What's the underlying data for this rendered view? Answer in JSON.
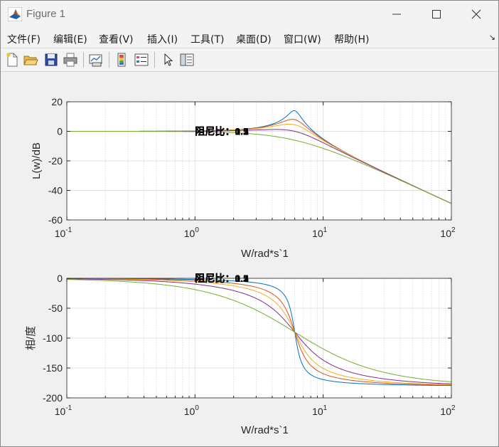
{
  "window": {
    "title": "Figure 1",
    "menu": [
      "文件(F)",
      "编辑(E)",
      "查看(V)",
      "插入(I)",
      "工具(T)",
      "桌面(D)",
      "窗口(W)",
      "帮助(H)"
    ],
    "menu_overflow": "↘",
    "toolbar_icons": [
      "new-figure-icon",
      "open-file-icon",
      "save-icon",
      "print-icon",
      "link-plot-icon",
      "colorbar-icon",
      "legend-icon",
      "pointer-icon",
      "property-editor-icon"
    ]
  },
  "colors": {
    "series": [
      "#0072BD",
      "#D95319",
      "#EDB120",
      "#7E2F8E",
      "#77AC30"
    ]
  },
  "chart_data": [
    {
      "type": "line",
      "subtype": "bode-magnitude",
      "xscale": "log",
      "xlim": [
        0.1,
        100
      ],
      "ylim": [
        -60,
        20
      ],
      "xticks": [
        0.1,
        1,
        10,
        100
      ],
      "xtick_labels": [
        {
          "base": "10",
          "exp": "-1"
        },
        {
          "base": "10",
          "exp": "0"
        },
        {
          "base": "10",
          "exp": "1"
        },
        {
          "base": "10",
          "exp": "2"
        }
      ],
      "yticks": [
        -60,
        -40,
        -20,
        0,
        20
      ],
      "ytick_labels": [
        "-60",
        "-40",
        "-20",
        "0",
        "20"
      ],
      "xlabel": "W/rad*s`1",
      "ylabel": "L(w)/dB",
      "grid": true,
      "annotation": {
        "prefix": "阻尼比：",
        "values": [
          "0.1",
          "0.2",
          "0.3",
          "0.5",
          "1"
        ],
        "x": 1,
        "y": 0
      },
      "omega_n": 6,
      "zetas": [
        0.1,
        0.2,
        0.3,
        0.5,
        1
      ],
      "series": [
        {
          "x": [
            0.1,
            1,
            3,
            5,
            6,
            7,
            10,
            20,
            50,
            100
          ],
          "values": [
            0.0,
            0.2,
            1.1,
            7.6,
            14.0,
            7.0,
            -2.1,
            -15.0,
            -36.8,
            -48.9
          ]
        },
        {
          "x": [
            0.1,
            1,
            3,
            5,
            6,
            7,
            10,
            20,
            50,
            100
          ],
          "values": [
            0.0,
            0.2,
            1.0,
            4.8,
            8.0,
            5.0,
            -2.3,
            -15.1,
            -36.8,
            -48.9
          ]
        },
        {
          "x": [
            0.1,
            1,
            3,
            5,
            6,
            7,
            10,
            20,
            50,
            100
          ],
          "values": [
            0.0,
            0.2,
            0.8,
            2.6,
            4.4,
            2.9,
            -2.8,
            -15.3,
            -36.8,
            -48.9
          ]
        },
        {
          "x": [
            0.1,
            1,
            3,
            5,
            6,
            7,
            10,
            20,
            50,
            100
          ],
          "values": [
            0.0,
            0.1,
            0.2,
            0.6,
            0.0,
            -0.8,
            -4.6,
            -15.8,
            -36.9,
            -48.9
          ]
        },
        {
          "x": [
            0.1,
            1,
            3,
            5,
            6,
            7,
            10,
            20,
            50,
            100
          ],
          "values": [
            0.0,
            -0.2,
            -1.9,
            -4.8,
            -6.0,
            -7.4,
            -10.6,
            -21.4,
            -38.1,
            -49.2
          ]
        }
      ]
    },
    {
      "type": "line",
      "subtype": "bode-phase",
      "xscale": "log",
      "xlim": [
        0.1,
        100
      ],
      "ylim": [
        -200,
        0
      ],
      "xticks": [
        0.1,
        1,
        10,
        100
      ],
      "xtick_labels": [
        {
          "base": "10",
          "exp": "-1"
        },
        {
          "base": "10",
          "exp": "0"
        },
        {
          "base": "10",
          "exp": "1"
        },
        {
          "base": "10",
          "exp": "2"
        }
      ],
      "yticks": [
        -200,
        -150,
        -100,
        -50,
        0
      ],
      "ytick_labels": [
        "-200",
        "-150",
        "-100",
        "-50",
        "0"
      ],
      "xlabel": "W/rad*s`1",
      "ylabel": "相/度",
      "grid": true,
      "annotation": {
        "prefix": "阻尼比：",
        "values": [
          "0.1",
          "0.2",
          "0.3",
          "0.5",
          "1"
        ],
        "x": 1,
        "y": 0
      },
      "omega_n": 6,
      "zetas": [
        0.1,
        0.2,
        0.3,
        0.5,
        1
      ],
      "series": [
        {
          "x": [
            0.1,
            1,
            3,
            5,
            6,
            7,
            10,
            20,
            50,
            100
          ],
          "values": [
            -0.2,
            -2.0,
            -7.6,
            -40.1,
            -90.0,
            -145.0,
            -167.0,
            -176.5,
            -178.6,
            -179.3
          ]
        },
        {
          "x": [
            0.1,
            1,
            3,
            5,
            6,
            7,
            10,
            20,
            50,
            100
          ],
          "values": [
            -0.4,
            -3.9,
            -15.0,
            -59.0,
            -90.0,
            -122.0,
            -154.0,
            -173.0,
            -177.2,
            -178.6
          ]
        },
        {
          "x": [
            0.1,
            1,
            3,
            5,
            6,
            7,
            10,
            20,
            50,
            100
          ],
          "values": [
            -0.6,
            -5.9,
            -21.8,
            -67.0,
            -90.0,
            -112.0,
            -142.0,
            -169.6,
            -175.9,
            -177.9
          ]
        },
        {
          "x": [
            0.1,
            1,
            3,
            5,
            6,
            7,
            10,
            20,
            50,
            100
          ],
          "values": [
            -1.0,
            -9.7,
            -33.7,
            -73.6,
            -90.0,
            -104.0,
            -130.9,
            -163.3,
            -173.2,
            -176.6
          ]
        },
        {
          "x": [
            0.1,
            1,
            3,
            5,
            6,
            7,
            10,
            20,
            50,
            100
          ],
          "values": [
            -1.9,
            -18.9,
            -53.1,
            -79.6,
            -90.0,
            -98.7,
            -115.9,
            -147.0,
            -166.6,
            -173.2
          ]
        }
      ]
    }
  ]
}
